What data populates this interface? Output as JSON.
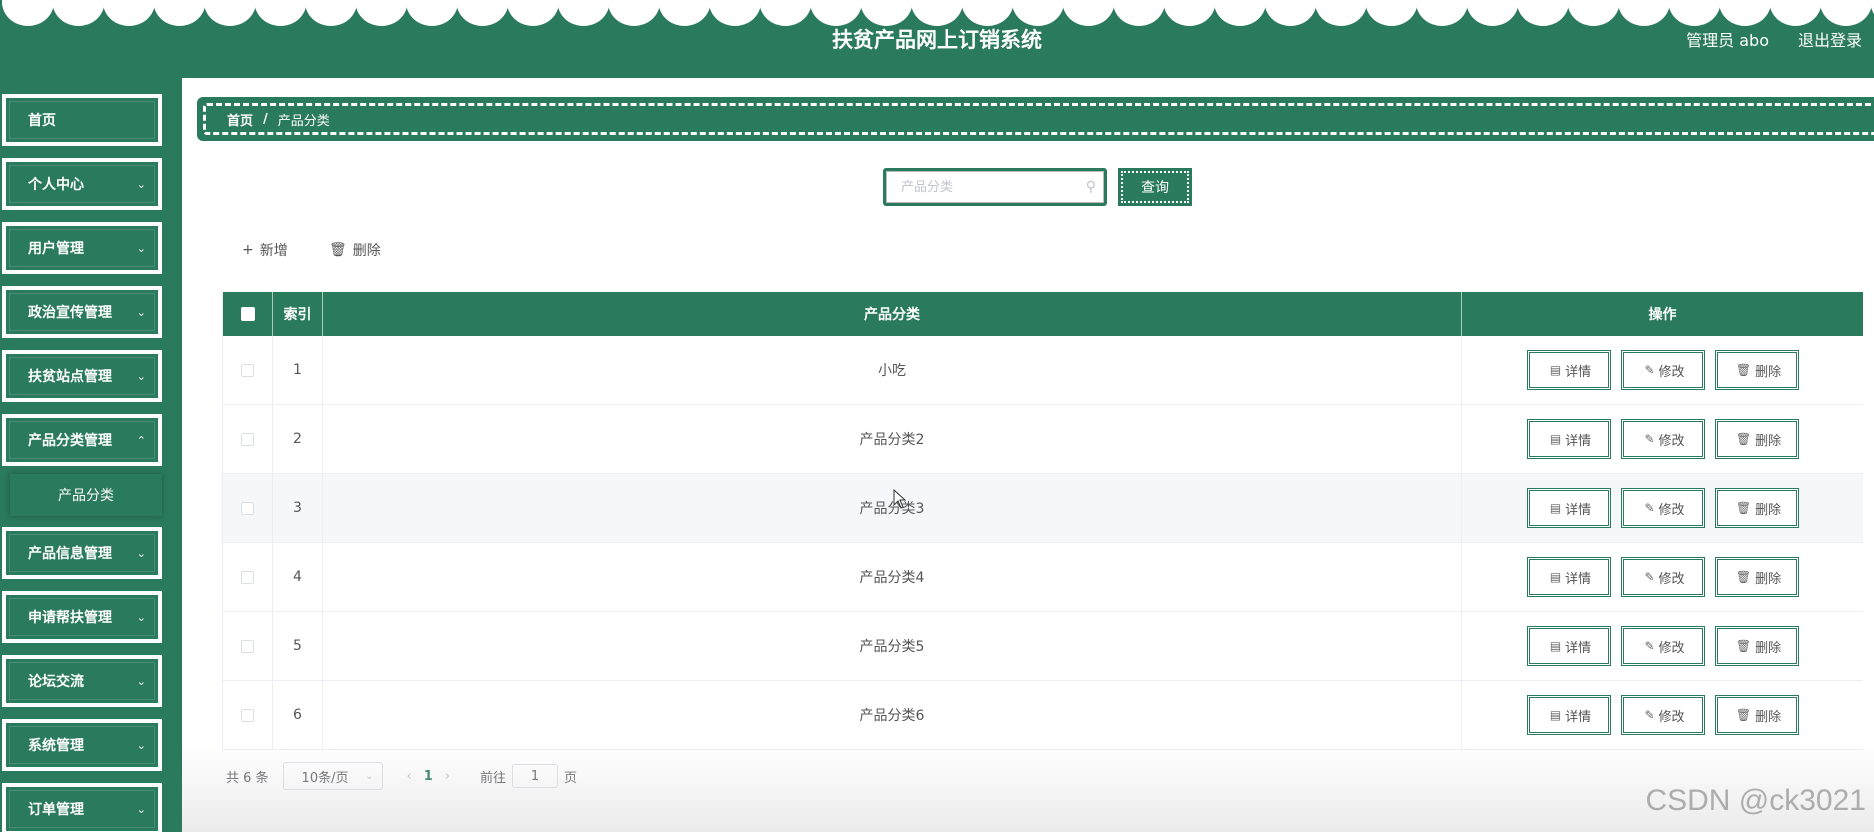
{
  "header": {
    "app_title": "扶贫产品网上订销系统",
    "user_label": "管理员 abo",
    "logout_label": "退出登录"
  },
  "sidebar": {
    "items": [
      {
        "label": "首页",
        "has_children": false
      },
      {
        "label": "个人中心",
        "has_children": true
      },
      {
        "label": "用户管理",
        "has_children": true
      },
      {
        "label": "政治宣传管理",
        "has_children": true
      },
      {
        "label": "扶贫站点管理",
        "has_children": true
      },
      {
        "label": "产品分类管理",
        "has_children": true,
        "expanded": true
      },
      {
        "label": "产品信息管理",
        "has_children": true
      },
      {
        "label": "申请帮扶管理",
        "has_children": true
      },
      {
        "label": "论坛交流",
        "has_children": true
      },
      {
        "label": "系统管理",
        "has_children": true
      },
      {
        "label": "订单管理",
        "has_children": true
      }
    ],
    "sub_item": "产品分类"
  },
  "breadcrumb": {
    "home": "首页",
    "separator": "/",
    "current": "产品分类"
  },
  "search": {
    "placeholder": "产品分类",
    "value": "",
    "button_label": "查询"
  },
  "toolbar": {
    "add_label": "新增",
    "delete_label": "删除"
  },
  "table": {
    "columns": [
      "",
      "索引",
      "产品分类",
      "操作"
    ],
    "rows": [
      {
        "index": "1",
        "category": "小吃"
      },
      {
        "index": "2",
        "category": "产品分类2"
      },
      {
        "index": "3",
        "category": "产品分类3"
      },
      {
        "index": "4",
        "category": "产品分类4"
      },
      {
        "index": "5",
        "category": "产品分类5"
      },
      {
        "index": "6",
        "category": "产品分类6"
      }
    ],
    "row_actions": {
      "detail": "详情",
      "edit": "修改",
      "delete": "删除"
    }
  },
  "pagination": {
    "total_text": "共 6 条",
    "page_size": "10条/页",
    "current_page": "1",
    "goto_prefix": "前往",
    "goto_value": "1",
    "goto_suffix": "页"
  },
  "watermark": "CSDN @ck3021",
  "colors": {
    "primary": "#2a7a5e",
    "header_text": "#ffffff"
  }
}
